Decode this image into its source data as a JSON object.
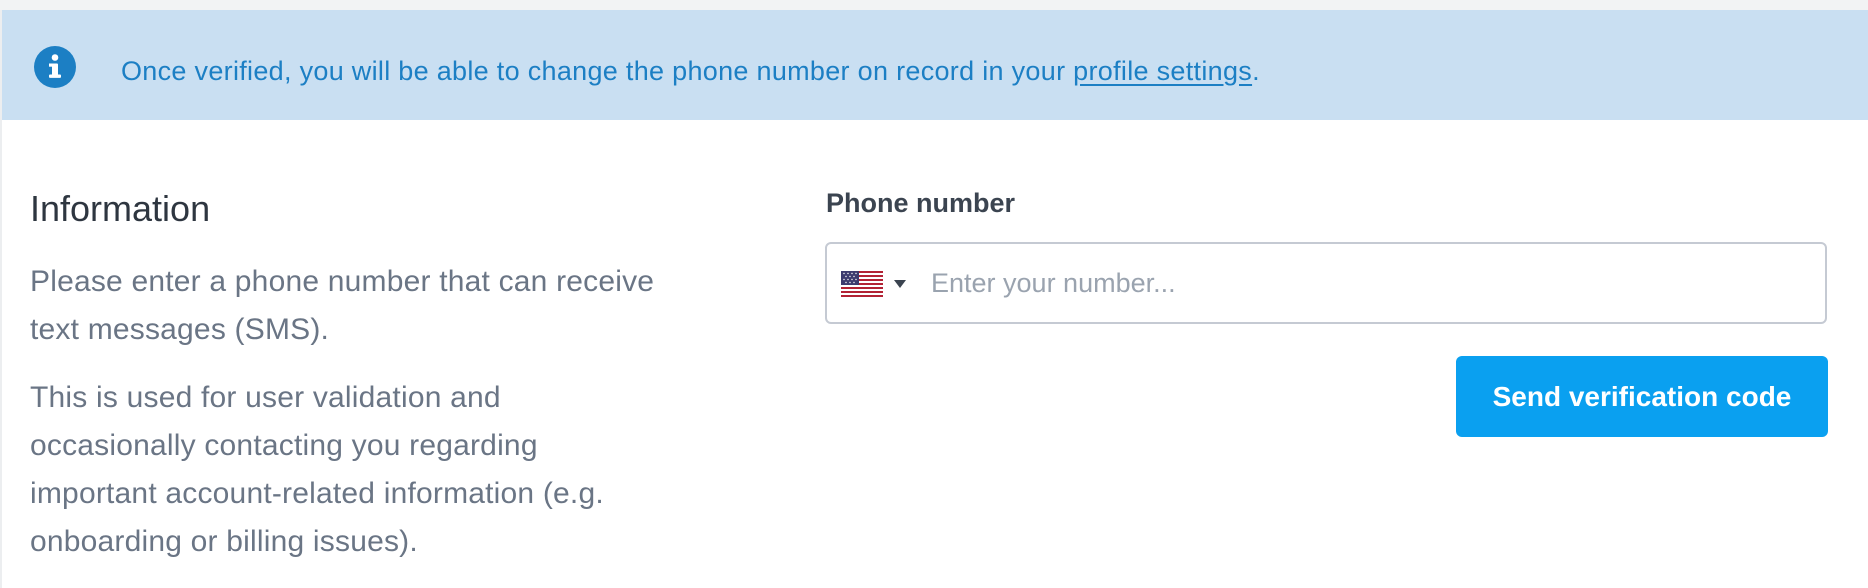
{
  "banner": {
    "icon": "info-icon",
    "message_prefix": "Once verified, you will be able to change the phone number on record in your ",
    "link_text": "profile settings",
    "message_suffix": ".",
    "text_color": "#1c7fc4",
    "background_color": "#c9dff2"
  },
  "info_section": {
    "title": "Information",
    "paragraph_1": "Please enter a phone number that can receive text messages (SMS).",
    "paragraph_2": "This is used for user validation and occasionally contacting you regarding important account-related information (e.g. onboarding or billing issues)."
  },
  "phone_form": {
    "label": "Phone number",
    "country_icon": "us-flag-icon",
    "dropdown_icon": "caret-down-icon",
    "value": "",
    "placeholder": "Enter your number...",
    "submit_label": "Send verification code",
    "accent_color": "#0aa0f0"
  }
}
